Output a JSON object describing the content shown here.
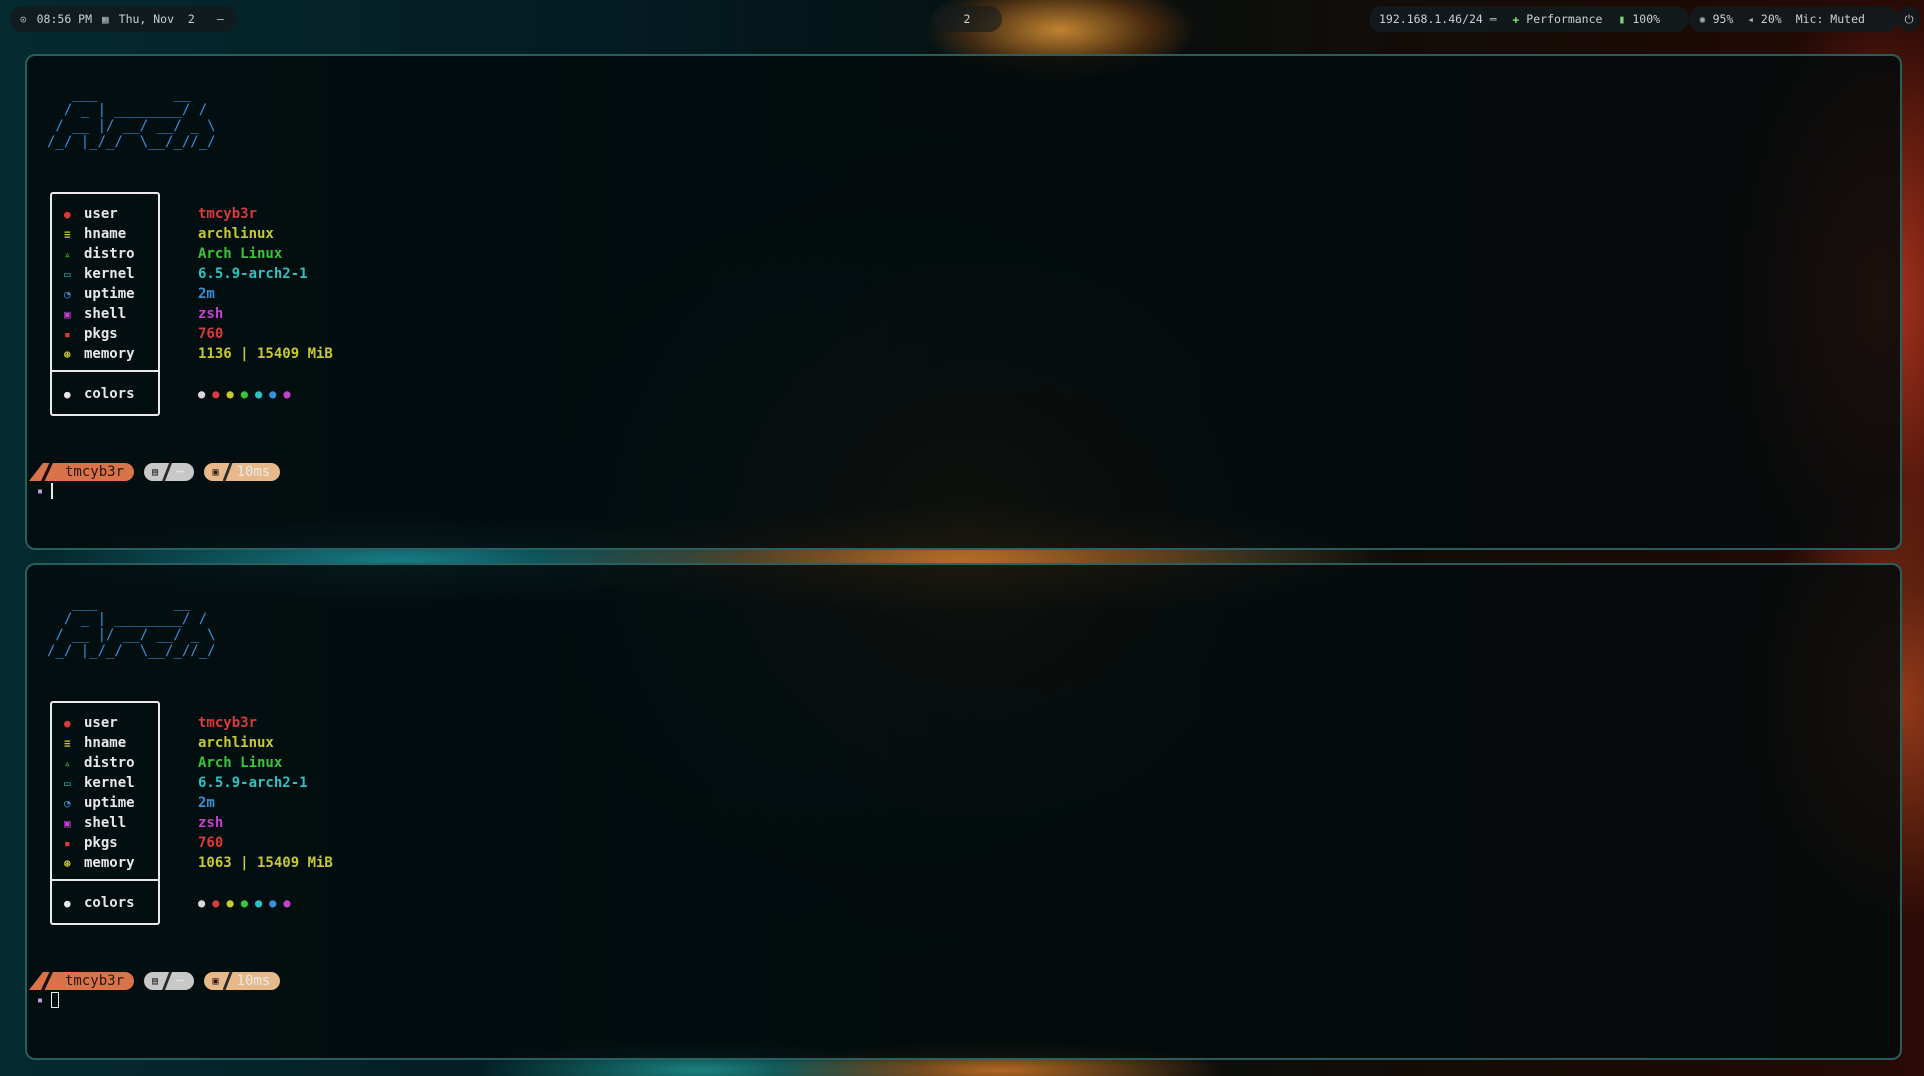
{
  "topbar": {
    "clock": {
      "icon": "clock-icon",
      "time": "08:56 PM"
    },
    "date": {
      "icon": "calendar-icon",
      "text": "Thu, Nov  2"
    },
    "extra": "–",
    "workspace": "2",
    "network": "192.168.1.46/24",
    "network_icon": "ethernet-icon",
    "power_profile": "Performance",
    "battery": "100%",
    "brightness": "95%",
    "volume": "20%",
    "mic": "Mic: Muted",
    "power_icon": "power-icon"
  },
  "terminals": [
    {
      "logo": "   ___         __\n  / _ | ________/ /\n / __ |/ __/ __/ _ \\\n/_/ |_/_/  \\__/_//_/",
      "info": [
        {
          "icon": "user-icon",
          "label": "user",
          "value": "tmcyb3r",
          "color": "#d83b3b"
        },
        {
          "icon": "hostname-icon",
          "label": "hname",
          "value": "archlinux",
          "color": "#c7c932"
        },
        {
          "icon": "distro-icon",
          "label": "distro",
          "value": "Arch Linux",
          "color": "#3cc43c"
        },
        {
          "icon": "kernel-icon",
          "label": "kernel",
          "value": "6.5.9-arch2-1",
          "color": "#2fc2c2"
        },
        {
          "icon": "uptime-icon",
          "label": "uptime",
          "value": "2m",
          "color": "#3b8fd6"
        },
        {
          "icon": "shell-icon",
          "label": "shell",
          "value": "zsh",
          "color": "#c83fd0"
        },
        {
          "icon": "package-icon",
          "label": "pkgs",
          "value": "760",
          "color": "#d83b3b"
        },
        {
          "icon": "memory-icon",
          "label": "memory",
          "value": "1136 | 15409 MiB",
          "color": "#c7c932"
        }
      ],
      "colors_label": "colors",
      "prompt": {
        "user": "tmcyb3r",
        "dir": "~",
        "duration": "10ms"
      },
      "cursor": "bar"
    },
    {
      "logo": "   ___         __\n  / _ | ________/ /\n / __ |/ __/ __/ _ \\\n/_/ |_/_/  \\__/_//_/",
      "info": [
        {
          "icon": "user-icon",
          "label": "user",
          "value": "tmcyb3r",
          "color": "#d83b3b"
        },
        {
          "icon": "hostname-icon",
          "label": "hname",
          "value": "archlinux",
          "color": "#c7c932"
        },
        {
          "icon": "distro-icon",
          "label": "distro",
          "value": "Arch Linux",
          "color": "#3cc43c"
        },
        {
          "icon": "kernel-icon",
          "label": "kernel",
          "value": "6.5.9-arch2-1",
          "color": "#2fc2c2"
        },
        {
          "icon": "uptime-icon",
          "label": "uptime",
          "value": "2m",
          "color": "#3b8fd6"
        },
        {
          "icon": "shell-icon",
          "label": "shell",
          "value": "zsh",
          "color": "#c83fd0"
        },
        {
          "icon": "package-icon",
          "label": "pkgs",
          "value": "760",
          "color": "#d83b3b"
        },
        {
          "icon": "memory-icon",
          "label": "memory",
          "value": "1063 | 15409 MiB",
          "color": "#c7c932"
        }
      ],
      "colors_label": "colors",
      "prompt": {
        "user": "tmcyb3r",
        "dir": "~",
        "duration": "10ms"
      },
      "cursor": "box"
    }
  ],
  "palette": [
    "#d9d9d9",
    "#d83b3b",
    "#c7c932",
    "#3cc43c",
    "#2fc2c2",
    "#3b8fd6",
    "#c83fd0"
  ]
}
